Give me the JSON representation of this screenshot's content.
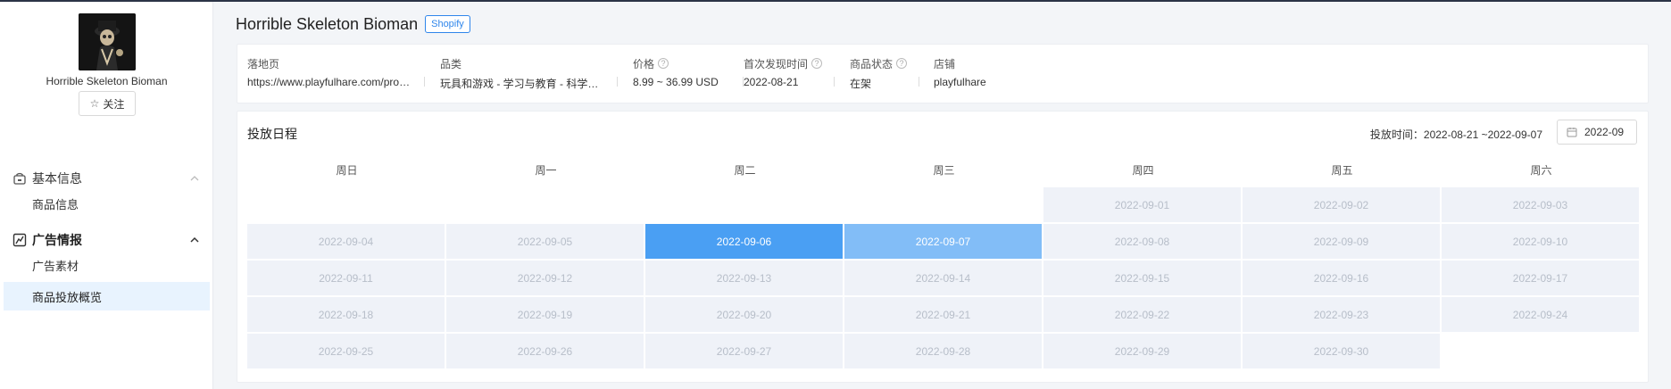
{
  "product": {
    "name": "Horrible Skeleton Bioman",
    "follow_label": "关注"
  },
  "sidebar": {
    "groups": [
      {
        "label": "基本信息",
        "icon": "shop-icon",
        "expanded": false,
        "items": [
          {
            "label": "商品信息"
          }
        ]
      },
      {
        "label": "广告情报",
        "icon": "chart-icon",
        "expanded": true,
        "items": [
          {
            "label": "广告素材"
          },
          {
            "label": "商品投放概览",
            "selected": true
          }
        ]
      }
    ]
  },
  "header": {
    "title": "Horrible Skeleton Bioman",
    "platform_badge": "Shopify"
  },
  "info": {
    "landing_label": "落地页",
    "landing_value": "https://www.playfulhare.com/products/horrible-skeleton-bioman",
    "category_label": "品类",
    "category_value": "玩具和游戏 - 学习与教育 - 科学套件",
    "price_label": "价格",
    "price_value": "8.99 ~ 36.99 USD",
    "first_seen_label": "首次发现时间",
    "first_seen_value": "2022-08-21",
    "status_label": "商品状态",
    "status_value": "在架",
    "store_label": "店铺",
    "store_value": "playfulhare"
  },
  "schedule": {
    "title": "投放日程",
    "range_label": "投放时间：2022-08-21 ~2022-09-07",
    "month_value": "2022-09",
    "weekdays": [
      "周日",
      "周一",
      "周二",
      "周三",
      "周四",
      "周五",
      "周六"
    ],
    "first_weekday_index": 4,
    "days": [
      "2022-09-01",
      "2022-09-02",
      "2022-09-03",
      "2022-09-04",
      "2022-09-05",
      "2022-09-06",
      "2022-09-07",
      "2022-09-08",
      "2022-09-09",
      "2022-09-10",
      "2022-09-11",
      "2022-09-12",
      "2022-09-13",
      "2022-09-14",
      "2022-09-15",
      "2022-09-16",
      "2022-09-17",
      "2022-09-18",
      "2022-09-19",
      "2022-09-20",
      "2022-09-21",
      "2022-09-22",
      "2022-09-23",
      "2022-09-24",
      "2022-09-25",
      "2022-09-26",
      "2022-09-27",
      "2022-09-28",
      "2022-09-29",
      "2022-09-30"
    ],
    "highlight_strong": [
      "2022-09-06"
    ],
    "highlight_light": [
      "2022-09-07"
    ]
  },
  "colors": {
    "accent": "#2f86eb",
    "highlight_strong": "#4a9ff3",
    "highlight_light": "#82bdf7",
    "cell_bg": "#eff2f8",
    "cell_text": "#b7bec9"
  }
}
